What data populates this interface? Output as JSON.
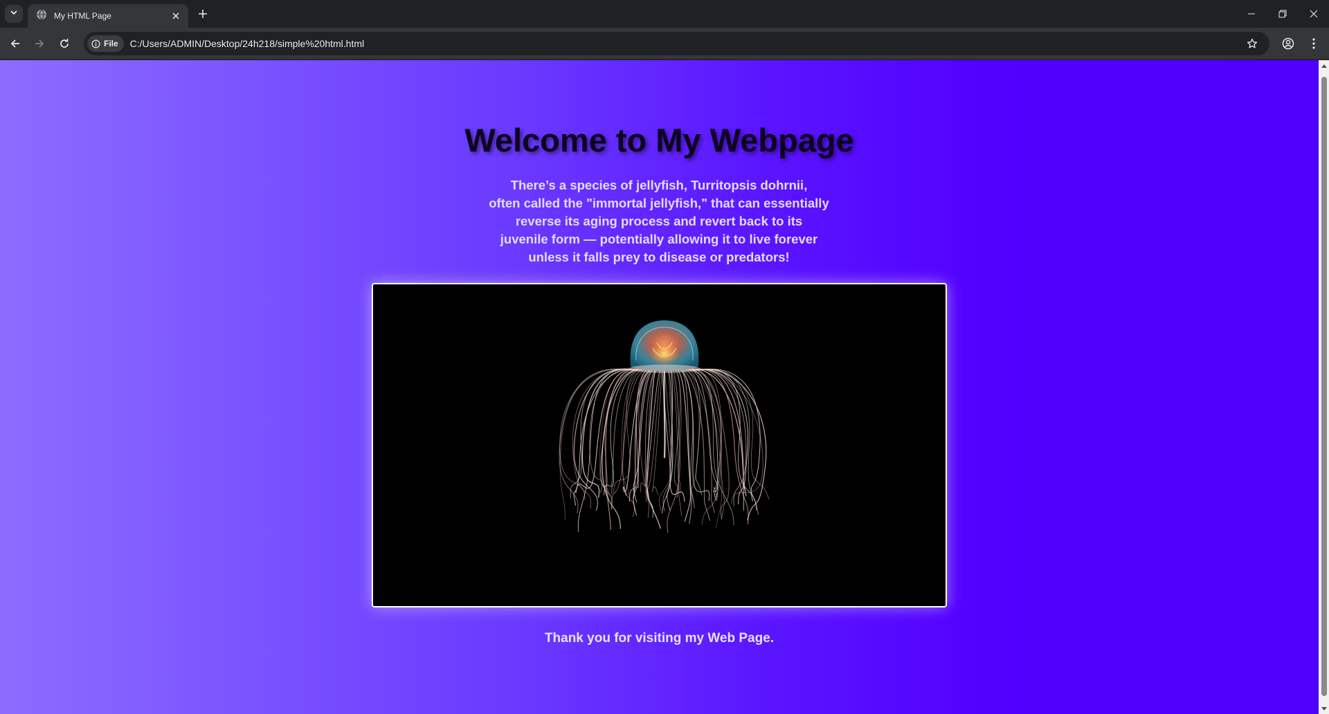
{
  "browser": {
    "tab": {
      "title": "My HTML Page"
    },
    "address_bar": {
      "scheme_label": "File",
      "url": "C:/Users/ADMIN/Desktop/24h218/simple%20html.html"
    }
  },
  "page": {
    "heading": "Welcome to My Webpage",
    "paragraph_lines": [
      "There’s a species of jellyfish, Turritopsis dohrnii,",
      "often called the \"immortal jellyfish,\" that can essentially",
      "reverse its aging process and revert back to its",
      "juvenile form — potentially allowing it to live forever",
      "unless it falls prey to disease or predators!"
    ],
    "image_subject": "jellyfish",
    "footer": "Thank you for visiting my Web Page."
  },
  "colors": {
    "gradient_left": "#8d6cff",
    "gradient_right": "#5000fb",
    "heading": "#0c0220",
    "body_text": "#e4dcff"
  },
  "icons": [
    "tab-search-icon",
    "globe-icon",
    "close-icon",
    "plus-icon",
    "minimize-icon",
    "restore-icon",
    "window-close-icon",
    "back-arrow-icon",
    "forward-arrow-icon",
    "reload-icon",
    "info-icon",
    "star-icon",
    "profile-icon",
    "kebab-menu-icon"
  ]
}
